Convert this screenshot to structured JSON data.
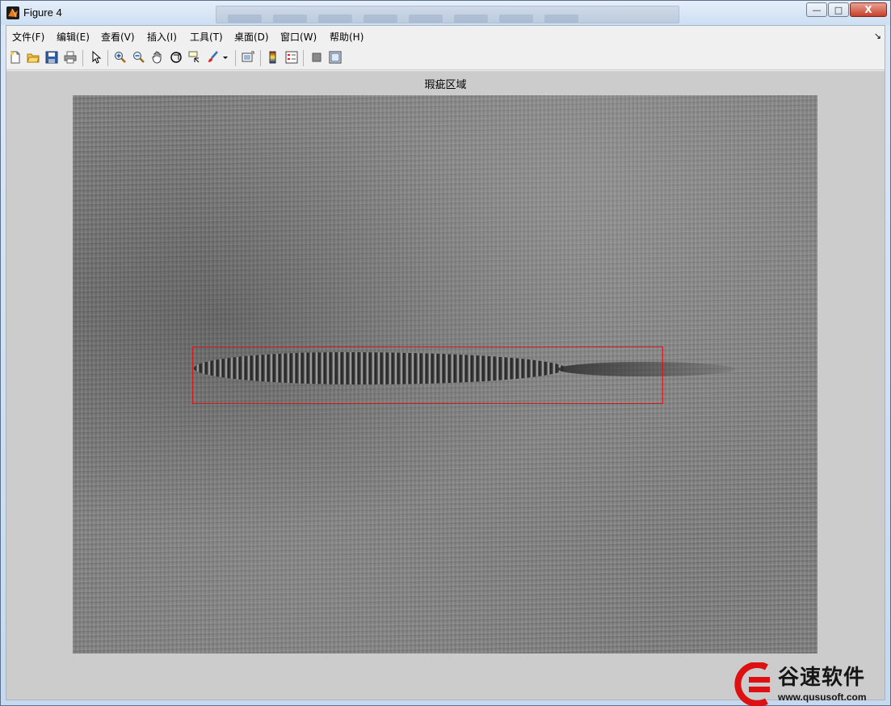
{
  "window": {
    "title": "Figure 4",
    "buttons": {
      "minimize": "—",
      "maximize": "□",
      "close": "X"
    }
  },
  "menu": {
    "items": [
      "文件(F)",
      "编辑(E)",
      "查看(V)",
      "插入(I)",
      "工具(T)",
      "桌面(D)",
      "窗口(W)",
      "帮助(H)"
    ],
    "overflow": "↘"
  },
  "toolbar": {
    "icons": [
      "new-figure-icon",
      "open-file-icon",
      "save-icon",
      "print-icon",
      "edit-plot-arrow-icon",
      "zoom-in-icon",
      "zoom-out-icon",
      "pan-hand-icon",
      "rotate-3d-icon",
      "data-cursor-icon",
      "brush-icon",
      "brush-dropdown-icon",
      "link-plot-icon",
      "colorbar-icon",
      "legend-icon",
      "hide-plot-tools-icon",
      "show-plot-tools-icon"
    ]
  },
  "figure": {
    "axes_title": "瑕疵区域"
  },
  "colors": {
    "bbox": "#d21a1a",
    "close_button": "#c7402a"
  },
  "watermark": {
    "title": "谷速软件",
    "url": "www.qususoft.com"
  }
}
